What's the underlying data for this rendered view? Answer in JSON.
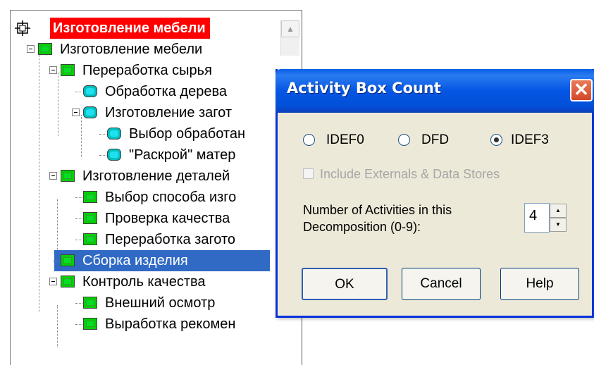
{
  "tree": {
    "root_label": "Изготовление мебели",
    "items": [
      {
        "label": "Изготовление мебели"
      },
      {
        "label": "Переработка сырья"
      },
      {
        "label": "Обработка дерева"
      },
      {
        "label": "Изготовление загот"
      },
      {
        "label": "Выбор обработан"
      },
      {
        "label": "\"Раскрой\" матер"
      },
      {
        "label": "Изготовление деталей"
      },
      {
        "label": "Выбор  способа изго"
      },
      {
        "label": "Проверка  качества"
      },
      {
        "label": "Переработка загото"
      },
      {
        "label": "Сборка изделия"
      },
      {
        "label": "Контроль качества"
      },
      {
        "label": "Внешний осмотр"
      },
      {
        "label": "Выработка  рекомен"
      }
    ],
    "selected_label": "Сборка изделия"
  },
  "dialog": {
    "title": "Activity Box Count",
    "close_glyph": "✕",
    "radios": [
      {
        "label": "IDEF0",
        "checked": false
      },
      {
        "label": "DFD",
        "checked": false
      },
      {
        "label": "IDEF3",
        "checked": true
      }
    ],
    "checkbox_label": "Include Externals & Data Stores",
    "checkbox_enabled": false,
    "count_label": "Number of Activities in this Decomposition (0-9):",
    "count_value": "4",
    "buttons": {
      "ok": "OK",
      "cancel": "Cancel",
      "help": "Help"
    }
  },
  "colors": {
    "selection": "#316ac5",
    "root_highlight": "#ff0000",
    "titlebar": "#0456e4",
    "dialog_bg": "#ece9d8"
  }
}
